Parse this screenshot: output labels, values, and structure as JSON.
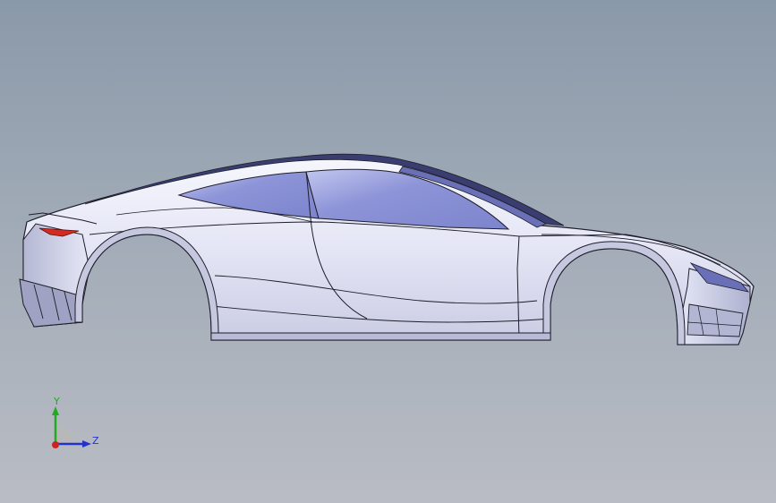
{
  "viewport": {
    "background_top": "#8a99a9",
    "background_bottom": "#b9bcc4"
  },
  "model": {
    "name": "car-body-side-view",
    "body_color": "#e2e4f4",
    "glass_color": "#8c93d6",
    "edge_color": "#1e1e2a",
    "taillight_color": "#d42a20"
  },
  "triad": {
    "y_label": "Y",
    "z_label": "Z",
    "y_color": "#22aa22",
    "z_color": "#2233cc",
    "x_color": "#cc2222"
  }
}
